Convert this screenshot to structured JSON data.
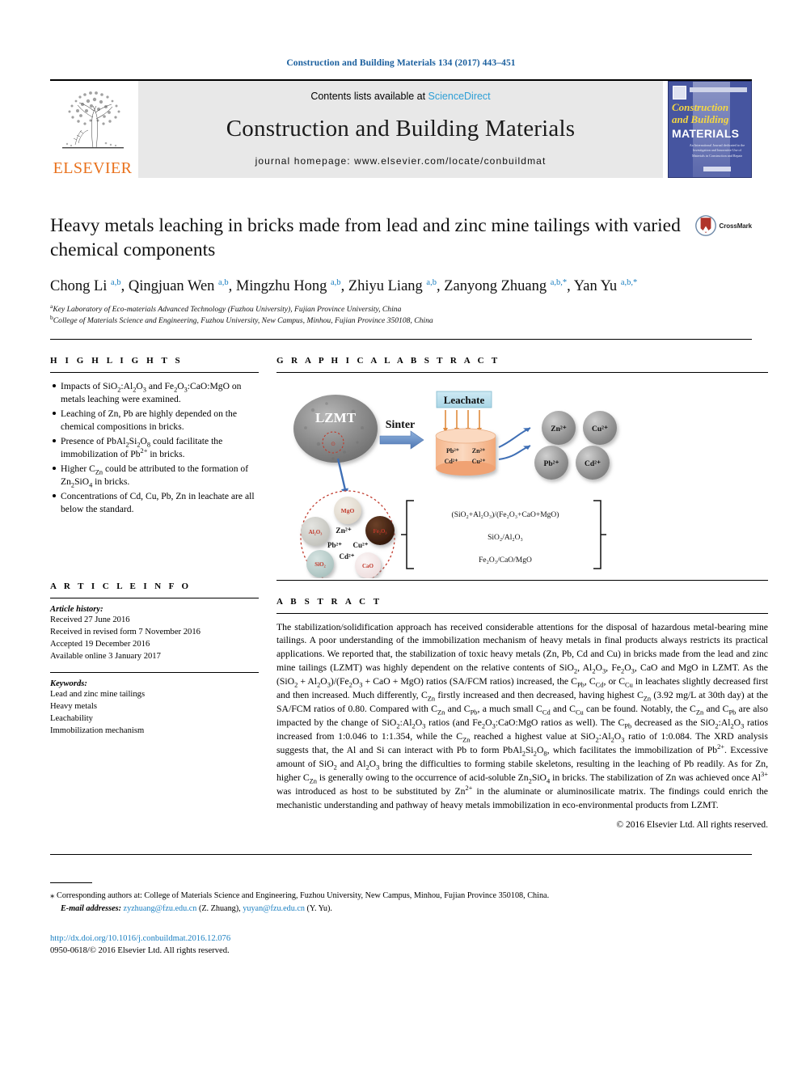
{
  "running_head": "Construction and Building Materials 134 (2017) 443–451",
  "masthead": {
    "publisher_name": "ELSEVIER",
    "contents_prefix": "Contents lists available at ",
    "sciencedirect": "ScienceDirect",
    "journal_title": "Construction and Building Materials",
    "homepage": "journal homepage: www.elsevier.com/locate/conbuildmat",
    "cover": {
      "line1": "Construction",
      "line2": "and Building",
      "line3": "MATERIALS",
      "blurb": "An International Journal dedicated to the Investigation and Innovative Use of Materials in Construction and Repair",
      "imprint": "ELSEVIER"
    }
  },
  "article": {
    "title": "Heavy metals leaching in bricks made from lead and zinc mine tailings with varied chemical components",
    "crossmark_label": "CrossMark",
    "authors_html": "Chong Li <sup>a,b</sup>, Qingjuan Wen <sup>a,b</sup>, Mingzhu Hong <sup>a,b</sup>, Zhiyu Liang <sup>a,b</sup>, Zanyong Zhuang <sup>a,b,</sup><sup>*</sup>, Yan Yu <sup>a,b,</sup><sup>*</sup>",
    "affiliations": [
      {
        "marker": "a",
        "text": "Key Laboratory of Eco-materials Advanced Technology (Fuzhou University), Fujian Province University, China"
      },
      {
        "marker": "b",
        "text": "College of Materials Science and Engineering, Fuzhou University, New Campus, Minhou, Fujian Province 350108, China"
      }
    ]
  },
  "highlights": {
    "heading": "H I G H L I G H T S",
    "items_html": [
      "Impacts of SiO<sub>2</sub>:Al<sub>2</sub>O<sub>3</sub> and Fe<sub>2</sub>O<sub>3</sub>:CaO:MgO on metals leaching were examined.",
      "Leaching of Zn, Pb are highly depended on the chemical compositions in bricks.",
      "Presence of PbAl<sub>2</sub>Si<sub>2</sub>O<sub>8</sub> could facilitate the immobilization of Pb<sup>2+</sup> in bricks.",
      "Higher C<sub>Zn</sub> could be attributed to the formation of Zn<sub>2</sub>SiO<sub>4</sub> in bricks.",
      "Concentrations of Cd, Cu, Pb, Zn in leachate are all below the standard."
    ]
  },
  "graphical_abstract": {
    "heading": "G R A P H I C A L   A B S T R A C T",
    "labels": {
      "lzmt": "LZMT",
      "sinter": "Sinter",
      "leachate": "Leachate",
      "brick_ions": [
        "Pb2+",
        "Zn2+",
        "Cd2+",
        "Cu2+"
      ],
      "released_ions": [
        "Zn2+",
        "Cu2+",
        "Pb2+",
        "Cd2+"
      ],
      "oxides": [
        "MgO",
        "Al2O3",
        "Fe2O3",
        "SiO2",
        "CaO"
      ],
      "inner_ions": [
        "Zn2+",
        "Pb2+",
        "Cu2+",
        "Cd2+"
      ],
      "ratios": [
        "(SiO2+Al2O3)/(Fe2O3+CaO+MgO)",
        "SiO2/Al2O3",
        "Fe2O3/CaO/MgO"
      ]
    },
    "colors": {
      "leachate_box": "#bfe3ef",
      "cylinder": "#f7c4a0",
      "arrow_blue": "#5b86c4",
      "dotted_red": "#c0392b",
      "sphere_gray": "#9a9a9a"
    }
  },
  "article_info": {
    "heading": "A R T I C L E   I N F O",
    "history_label": "Article history:",
    "history": [
      "Received 27 June 2016",
      "Received in revised form 7 November 2016",
      "Accepted 19 December 2016",
      "Available online 3 January 2017"
    ],
    "keywords_label": "Keywords:",
    "keywords": [
      "Lead and zinc mine tailings",
      "Heavy metals",
      "Leachability",
      "Immobilization mechanism"
    ]
  },
  "abstract": {
    "heading": "A B S T R A C T",
    "body_html": "The stabilization/solidification approach has received considerable attentions for the disposal of hazardous metal-bearing mine tailings. A poor understanding of the immobilization mechanism of heavy metals in final products always restricts its practical applications. We reported that, the stabilization of toxic heavy metals (Zn, Pb, Cd and Cu) in bricks made from the lead and zinc mine tailings (LZMT) was highly dependent on the relative contents of SiO<sub>2</sub>, Al<sub>2</sub>O<sub>3</sub>, Fe<sub>2</sub>O<sub>3</sub>, CaO and MgO in LZMT. As the (SiO<sub>2</sub> + Al<sub>2</sub>O<sub>3</sub>)/(Fe<sub>2</sub>O<sub>3</sub> + CaO + MgO) ratios (SA/FCM ratios) increased, the C<sub>Pb</sub>, C<sub>Cd</sub>, or C<sub>Cu</sub> in leachates slightly decreased first and then increased. Much differently, C<sub>Zn</sub> firstly increased and then decreased, having highest C<sub>Zn</sub> (3.92 mg/L at 30th day) at the SA/FCM ratios of 0.80. Compared with C<sub>Zn</sub> and C<sub>Pb</sub>, a much small C<sub>Cd</sub> and C<sub>Cu</sub> can be found. Notably, the C<sub>Zn</sub> and C<sub>Pb</sub> are also impacted by the change of SiO<sub>2</sub>:Al<sub>2</sub>O<sub>3</sub> ratios (and Fe<sub>2</sub>O<sub>3</sub>:CaO:MgO ratios as well). The C<sub>Pb</sub> decreased as the SiO<sub>2</sub>:Al<sub>2</sub>O<sub>3</sub> ratios increased from 1:0.046 to 1:1.354, while the C<sub>Zn</sub> reached a highest value at SiO<sub>2</sub>:Al<sub>2</sub>O<sub>3</sub> ratio of 1:0.084. The XRD analysis suggests that, the Al and Si can interact with Pb to form PbAl<sub>2</sub>Si<sub>2</sub>O<sub>8</sub>, which facilitates the immobilization of Pb<sup>2+</sup>. Excessive amount of SiO<sub>2</sub> and Al<sub>2</sub>O<sub>3</sub> bring the difficulties to forming stabile skeletons, resulting in the leaching of Pb readily. As for Zn, higher C<sub>Zn</sub> is generally owing to the occurrence of acid-soluble Zn<sub>2</sub>SiO<sub>4</sub> in bricks. The stabilization of Zn was achieved once Al<sup>3+</sup> was introduced as host to be substituted by Zn<sup>2+</sup> in the aluminate or aluminosilicate matrix. The findings could enrich the mechanistic understanding and pathway of heavy metals immobilization in eco-environmental products from LZMT.",
    "copyright": "© 2016 Elsevier Ltd. All rights reserved."
  },
  "footnotes": {
    "corresponding_marker": "⁎",
    "corresponding": "Corresponding authors at: College of Materials Science and Engineering, Fuzhou University, New Campus, Minhou, Fujian Province 350108, China.",
    "email_label": "E-mail addresses:",
    "emails": [
      {
        "address": "zyzhuang@fzu.edu.cn",
        "owner": "(Z. Zhuang)"
      },
      {
        "address": "yuyan@fzu.edu.cn",
        "owner": "(Y. Yu)"
      }
    ]
  },
  "footer": {
    "doi": "http://dx.doi.org/10.1016/j.conbuildmat.2016.12.076",
    "issn_line": "0950-0618/© 2016 Elsevier Ltd. All rights reserved."
  }
}
